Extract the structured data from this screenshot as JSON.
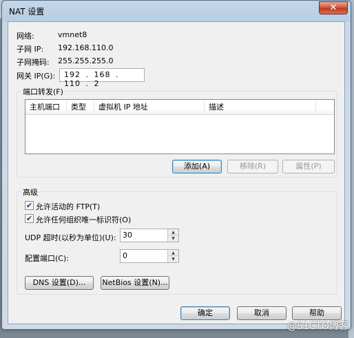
{
  "window": {
    "title": "NAT 设置",
    "close_label": "✕"
  },
  "info": {
    "network_label": "网络:",
    "network_value": "vmnet8",
    "subnet_ip_label": "子网 IP:",
    "subnet_ip_value": "192.168.110.0",
    "subnet_mask_label": "子网掩码:",
    "subnet_mask_value": "255.255.255.0",
    "gateway_label": "网关 IP(G):",
    "gateway_value": "192 . 168 . 110 . 2"
  },
  "port_forwarding": {
    "group_label": "端口转发(F)",
    "columns": [
      "主机端口",
      "类型",
      "虚拟机 IP 地址",
      "描述"
    ],
    "rows": [],
    "add_label": "添加(A)",
    "remove_label": "移除(R)",
    "properties_label": "属性(P)"
  },
  "advanced": {
    "group_label": "高级",
    "allow_ftp_label": "允许活动的 FTP(T)",
    "allow_ftp_checked": true,
    "allow_oui_label": "允许任何组织唯一标识符(O)",
    "allow_oui_checked": true,
    "udp_timeout_label": "UDP 超时(以秒为单位)(U):",
    "udp_timeout_value": "30",
    "config_port_label": "配置端口(C):",
    "config_port_value": "0",
    "dns_label": "DNS 设置(D)...",
    "netbios_label": "NetBios 设置(N)..."
  },
  "footer": {
    "ok_label": "确定",
    "cancel_label": "取消",
    "help_label": "帮助"
  },
  "watermark": "@51CTO博客"
}
